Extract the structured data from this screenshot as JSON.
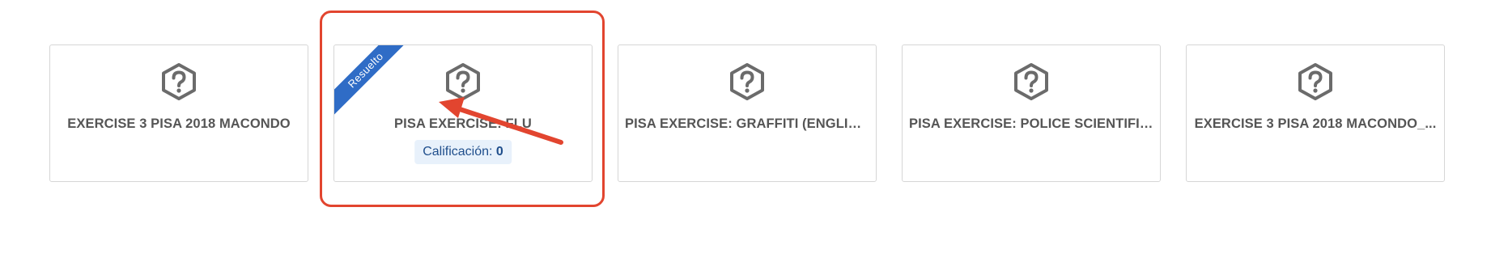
{
  "cards": [
    {
      "title": "EXERCISE 3 PISA 2018 MACONDO"
    },
    {
      "title": "PISA EXERCISE: FLU",
      "ribbon": "Resuelto",
      "grade_label": "Calificación:",
      "grade_value": "0"
    },
    {
      "title": "PISA EXERCISE: GRAFFITI (ENGLISH)"
    },
    {
      "title": "PISA EXERCISE: POLICE SCIENTIFIC..."
    },
    {
      "title": "EXERCISE 3 PISA 2018 MACONDO_..."
    }
  ],
  "icon": "help-question-hexagon-icon",
  "colors": {
    "icon": "#6b6b6b",
    "ribbon": "#2f6cc6",
    "highlight": "#e2452f",
    "grade_bg": "#e8f1fb",
    "grade_text": "#1f4e8c"
  }
}
